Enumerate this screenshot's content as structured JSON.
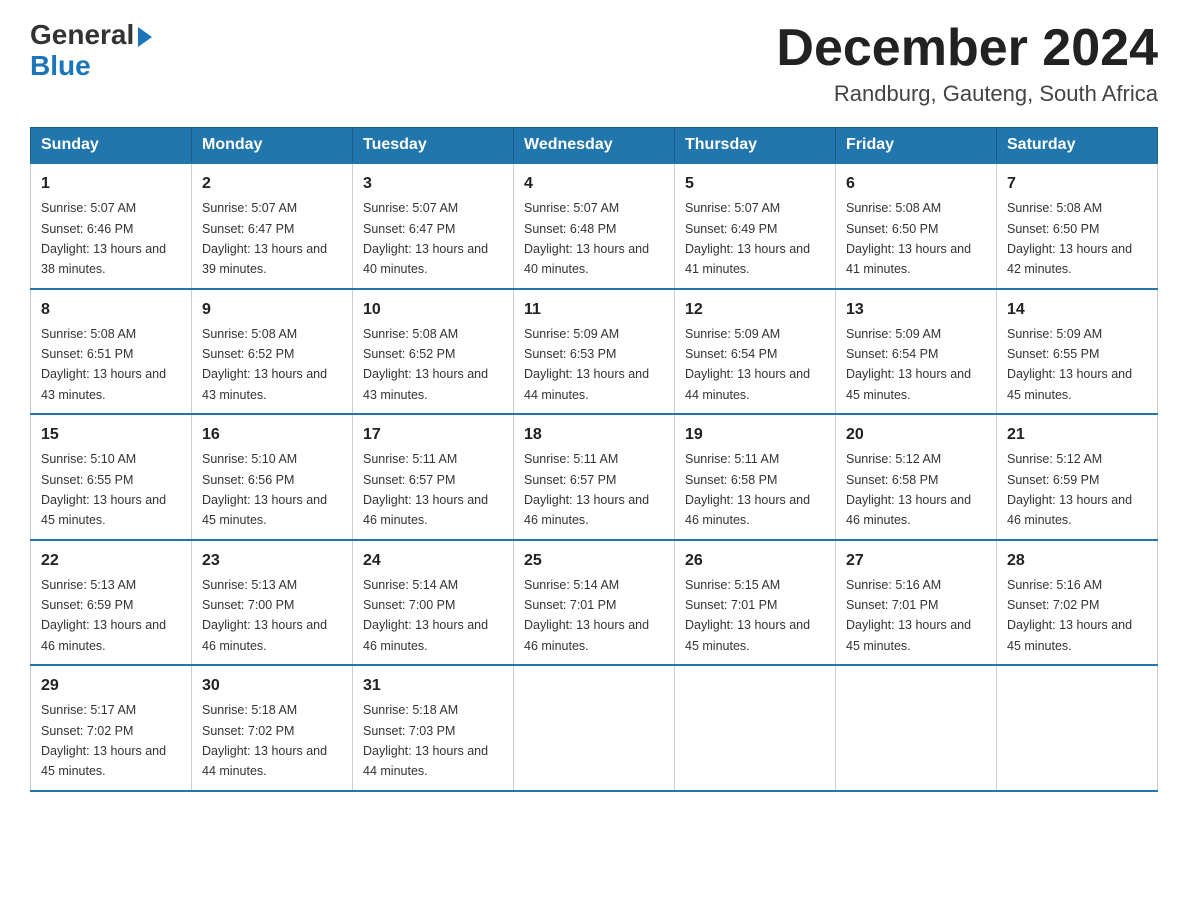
{
  "logo": {
    "general": "General",
    "blue": "Blue"
  },
  "title": "December 2024",
  "location": "Randburg, Gauteng, South Africa",
  "weekdays": [
    "Sunday",
    "Monday",
    "Tuesday",
    "Wednesday",
    "Thursday",
    "Friday",
    "Saturday"
  ],
  "weeks": [
    [
      {
        "day": "1",
        "sunrise": "5:07 AM",
        "sunset": "6:46 PM",
        "daylight": "13 hours and 38 minutes."
      },
      {
        "day": "2",
        "sunrise": "5:07 AM",
        "sunset": "6:47 PM",
        "daylight": "13 hours and 39 minutes."
      },
      {
        "day": "3",
        "sunrise": "5:07 AM",
        "sunset": "6:47 PM",
        "daylight": "13 hours and 40 minutes."
      },
      {
        "day": "4",
        "sunrise": "5:07 AM",
        "sunset": "6:48 PM",
        "daylight": "13 hours and 40 minutes."
      },
      {
        "day": "5",
        "sunrise": "5:07 AM",
        "sunset": "6:49 PM",
        "daylight": "13 hours and 41 minutes."
      },
      {
        "day": "6",
        "sunrise": "5:08 AM",
        "sunset": "6:50 PM",
        "daylight": "13 hours and 41 minutes."
      },
      {
        "day": "7",
        "sunrise": "5:08 AM",
        "sunset": "6:50 PM",
        "daylight": "13 hours and 42 minutes."
      }
    ],
    [
      {
        "day": "8",
        "sunrise": "5:08 AM",
        "sunset": "6:51 PM",
        "daylight": "13 hours and 43 minutes."
      },
      {
        "day": "9",
        "sunrise": "5:08 AM",
        "sunset": "6:52 PM",
        "daylight": "13 hours and 43 minutes."
      },
      {
        "day": "10",
        "sunrise": "5:08 AM",
        "sunset": "6:52 PM",
        "daylight": "13 hours and 43 minutes."
      },
      {
        "day": "11",
        "sunrise": "5:09 AM",
        "sunset": "6:53 PM",
        "daylight": "13 hours and 44 minutes."
      },
      {
        "day": "12",
        "sunrise": "5:09 AM",
        "sunset": "6:54 PM",
        "daylight": "13 hours and 44 minutes."
      },
      {
        "day": "13",
        "sunrise": "5:09 AM",
        "sunset": "6:54 PM",
        "daylight": "13 hours and 45 minutes."
      },
      {
        "day": "14",
        "sunrise": "5:09 AM",
        "sunset": "6:55 PM",
        "daylight": "13 hours and 45 minutes."
      }
    ],
    [
      {
        "day": "15",
        "sunrise": "5:10 AM",
        "sunset": "6:55 PM",
        "daylight": "13 hours and 45 minutes."
      },
      {
        "day": "16",
        "sunrise": "5:10 AM",
        "sunset": "6:56 PM",
        "daylight": "13 hours and 45 minutes."
      },
      {
        "day": "17",
        "sunrise": "5:11 AM",
        "sunset": "6:57 PM",
        "daylight": "13 hours and 46 minutes."
      },
      {
        "day": "18",
        "sunrise": "5:11 AM",
        "sunset": "6:57 PM",
        "daylight": "13 hours and 46 minutes."
      },
      {
        "day": "19",
        "sunrise": "5:11 AM",
        "sunset": "6:58 PM",
        "daylight": "13 hours and 46 minutes."
      },
      {
        "day": "20",
        "sunrise": "5:12 AM",
        "sunset": "6:58 PM",
        "daylight": "13 hours and 46 minutes."
      },
      {
        "day": "21",
        "sunrise": "5:12 AM",
        "sunset": "6:59 PM",
        "daylight": "13 hours and 46 minutes."
      }
    ],
    [
      {
        "day": "22",
        "sunrise": "5:13 AM",
        "sunset": "6:59 PM",
        "daylight": "13 hours and 46 minutes."
      },
      {
        "day": "23",
        "sunrise": "5:13 AM",
        "sunset": "7:00 PM",
        "daylight": "13 hours and 46 minutes."
      },
      {
        "day": "24",
        "sunrise": "5:14 AM",
        "sunset": "7:00 PM",
        "daylight": "13 hours and 46 minutes."
      },
      {
        "day": "25",
        "sunrise": "5:14 AM",
        "sunset": "7:01 PM",
        "daylight": "13 hours and 46 minutes."
      },
      {
        "day": "26",
        "sunrise": "5:15 AM",
        "sunset": "7:01 PM",
        "daylight": "13 hours and 45 minutes."
      },
      {
        "day": "27",
        "sunrise": "5:16 AM",
        "sunset": "7:01 PM",
        "daylight": "13 hours and 45 minutes."
      },
      {
        "day": "28",
        "sunrise": "5:16 AM",
        "sunset": "7:02 PM",
        "daylight": "13 hours and 45 minutes."
      }
    ],
    [
      {
        "day": "29",
        "sunrise": "5:17 AM",
        "sunset": "7:02 PM",
        "daylight": "13 hours and 45 minutes."
      },
      {
        "day": "30",
        "sunrise": "5:18 AM",
        "sunset": "7:02 PM",
        "daylight": "13 hours and 44 minutes."
      },
      {
        "day": "31",
        "sunrise": "5:18 AM",
        "sunset": "7:03 PM",
        "daylight": "13 hours and 44 minutes."
      },
      null,
      null,
      null,
      null
    ]
  ]
}
